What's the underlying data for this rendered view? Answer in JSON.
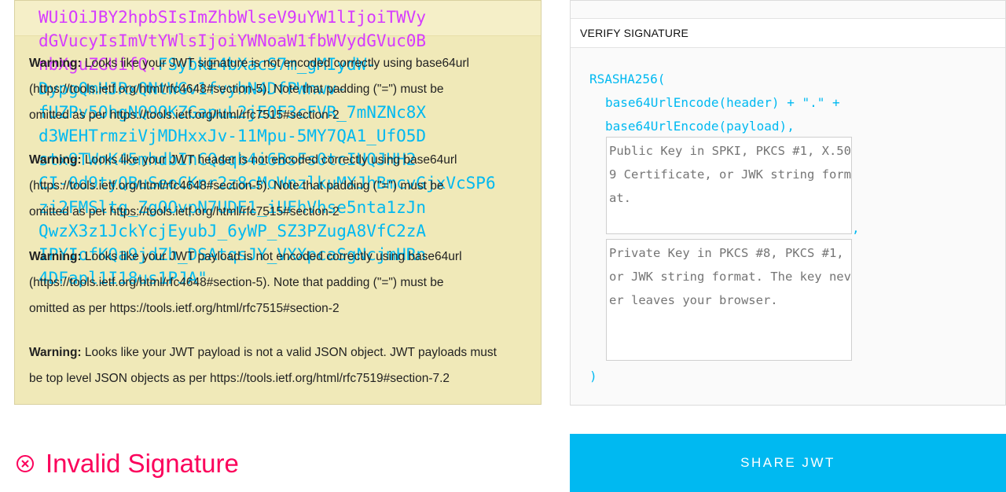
{
  "encoded": {
    "lines_pink": [
      "WUiOiJBY2hpbSIsImZhbWlseV9uYW1lIjoiTWVy",
      "dGVucyIsImVtYWlsIjoiYWNoaW1fbWVydGVuc0B",
      "nbXguZGUifQ."
    ],
    "line3_blue": "FSybkE4bXacS7m_gMIydW-",
    "lines_blue": [
      "DypgQmHJRxQNtWGv1fvyhN4DfPWnwv-",
      "fUZPv5OhgNQ9OKZGapuL2jEOF3cFVR_7mNZNc8X",
      "d3WEHTrmziVjMDHxxJv-11Mpu-5MY7QA1_UfO5D",
      "stx9TWnK45mhdbInCQsqb4i6BsFs0tcIUQJHH2",
      "CI-0d9tyQBuSeoCKnr2z8cMoWnzlkuMXJhBmcvGjxVcSP6",
      "zi2FMSltg_ZgOOvpN7UDE1_iUFhVhse5nta1zJn",
      "QwzX3z1JckYcjEyubJ_6yWP_SZ3PZugA8VfC2zA",
      "IPYIofKQa9jdZh_DSAtqsJY_VXXpcaSgNcjmHRn",
      "4DFapl1I18us1PJA\""
    ]
  },
  "warnings": [
    {
      "label": "Warning:",
      "line1": " Looks like your JWT signature is not encoded correctly using base64url",
      "line2": "(https://tools.ietf.org/html/rfc4648#section-5). Note that padding (\"=\") must be",
      "line3": "omitted as per https://tools.ietf.org/html/rfc7515#section-2"
    },
    {
      "label": "Warning:",
      "line1": " Looks like your JWT header is not encoded correctly using base64url",
      "line2": "(https://tools.ietf.org/html/rfc4648#section-5). Note that padding (\"=\") must be",
      "line3": "omitted as per https://tools.ietf.org/html/rfc7515#section-2"
    },
    {
      "label": "Warning:",
      "line1": " Looks like your JWT payload is not encoded correctly using base64url",
      "line2": "(https://tools.ietf.org/html/rfc4648#section-5). Note that padding (\"=\") must be",
      "line3": "omitted as per https://tools.ietf.org/html/rfc7515#section-2"
    },
    {
      "label": "Warning:",
      "line1": " Looks like your JWT payload is not a valid JSON object. JWT payloads must",
      "line2": "be top level JSON objects as per https://tools.ietf.org/html/rfc7519#section-7.2"
    }
  ],
  "verify": {
    "title": "VERIFY SIGNATURE",
    "algo": "RSASHA256(",
    "header_expr": "base64UrlEncode(header) + \".\" +",
    "payload_expr": "base64UrlEncode(payload),",
    "comma": ",",
    "close": ")",
    "public_key_placeholder": "Public Key in SPKI, PKCS #1, X.509 Certificate, or JWK string format.",
    "private_key_placeholder": "Private Key in PKCS #8, PKCS #1, or JWK string format. The key never leaves your browser."
  },
  "status": {
    "text": "Invalid Signature",
    "color": "#fb015b"
  },
  "share_button": "SHARE JWT",
  "colors": {
    "accent": "#00b9f1",
    "pink": "#d63aff",
    "warning_bg": "#f0e9b8"
  }
}
